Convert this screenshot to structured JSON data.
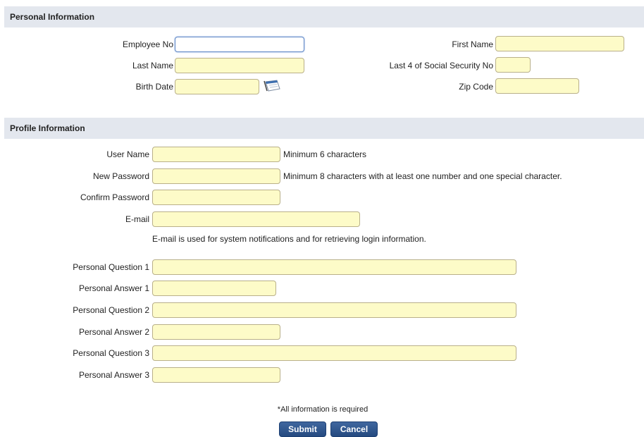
{
  "personal": {
    "title": "Personal Information",
    "employee_no": {
      "label": "Employee No",
      "value": ""
    },
    "first_name": {
      "label": "First Name",
      "value": ""
    },
    "last_name": {
      "label": "Last Name",
      "value": ""
    },
    "ssn_last4": {
      "label": "Last 4 of Social Security No",
      "value": ""
    },
    "birth_date": {
      "label": "Birth Date",
      "value": "",
      "icon": "calendar-icon"
    },
    "zip_code": {
      "label": "Zip Code",
      "value": ""
    }
  },
  "profile": {
    "title": "Profile Information",
    "user_name": {
      "label": "User Name",
      "value": "",
      "hint": "Minimum 6 characters"
    },
    "new_password": {
      "label": "New Password",
      "value": "",
      "hint": "Minimum 8 characters with at least one number and one special character."
    },
    "confirm_password": {
      "label": "Confirm Password",
      "value": ""
    },
    "email": {
      "label": "E-mail",
      "value": "",
      "hint": "E-mail is used for system notifications and for retrieving login information."
    },
    "question1": {
      "label": "Personal Question 1",
      "value": ""
    },
    "answer1": {
      "label": "Personal Answer 1",
      "value": ""
    },
    "question2": {
      "label": "Personal Question 2",
      "value": ""
    },
    "answer2": {
      "label": "Personal Answer 2",
      "value": ""
    },
    "question3": {
      "label": "Personal Question 3",
      "value": ""
    },
    "answer3": {
      "label": "Personal Answer 3",
      "value": ""
    }
  },
  "footer": {
    "required_note": "*All information is required",
    "submit_label": "Submit",
    "cancel_label": "Cancel"
  },
  "colors": {
    "section_header_bg": "#e3e7ee",
    "field_bg": "#fdfbc8",
    "button_bg": "#2f5a93"
  }
}
